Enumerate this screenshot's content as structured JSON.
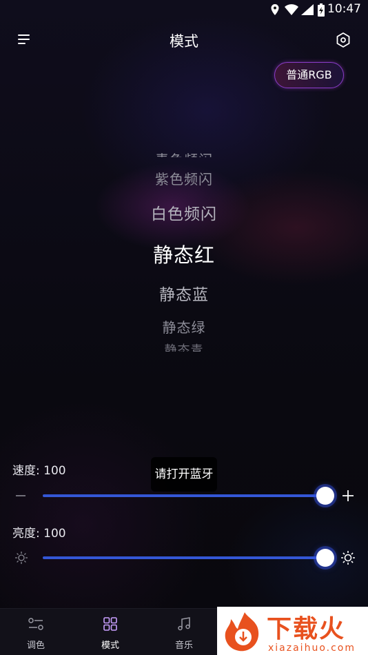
{
  "status_bar": {
    "time": "10:47"
  },
  "header": {
    "title": "模式"
  },
  "mode_button": {
    "label": "普通RGB"
  },
  "mode_picker": {
    "items": [
      {
        "label": "青色频闪",
        "state": "clipped-top"
      },
      {
        "label": "紫色频闪",
        "state": "far"
      },
      {
        "label": "白色频闪",
        "state": "near"
      },
      {
        "label": "静态红",
        "state": "selected"
      },
      {
        "label": "静态蓝",
        "state": "near"
      },
      {
        "label": "静态绿",
        "state": "far"
      },
      {
        "label": "静态青",
        "state": "clipped-bottom"
      }
    ],
    "selected": "静态红"
  },
  "speed": {
    "label": "速度: 100",
    "value": 100,
    "max": 100
  },
  "brightness": {
    "label": "亮度: 100",
    "value": 100,
    "max": 100
  },
  "toast": {
    "text": "请打开蓝牙"
  },
  "bottom_nav": {
    "items": [
      {
        "label": "调色",
        "icon": "sliders-icon",
        "active": false
      },
      {
        "label": "模式",
        "icon": "grid-icon",
        "active": true
      },
      {
        "label": "音乐",
        "icon": "music-note-icon",
        "active": false
      }
    ],
    "active_color": "#d6a8ff"
  },
  "watermark": {
    "brand": "下载火",
    "site": "xiazaihuo.com"
  },
  "colors": {
    "accent": "#3457d6",
    "pill_border": "#8a3cc8"
  }
}
